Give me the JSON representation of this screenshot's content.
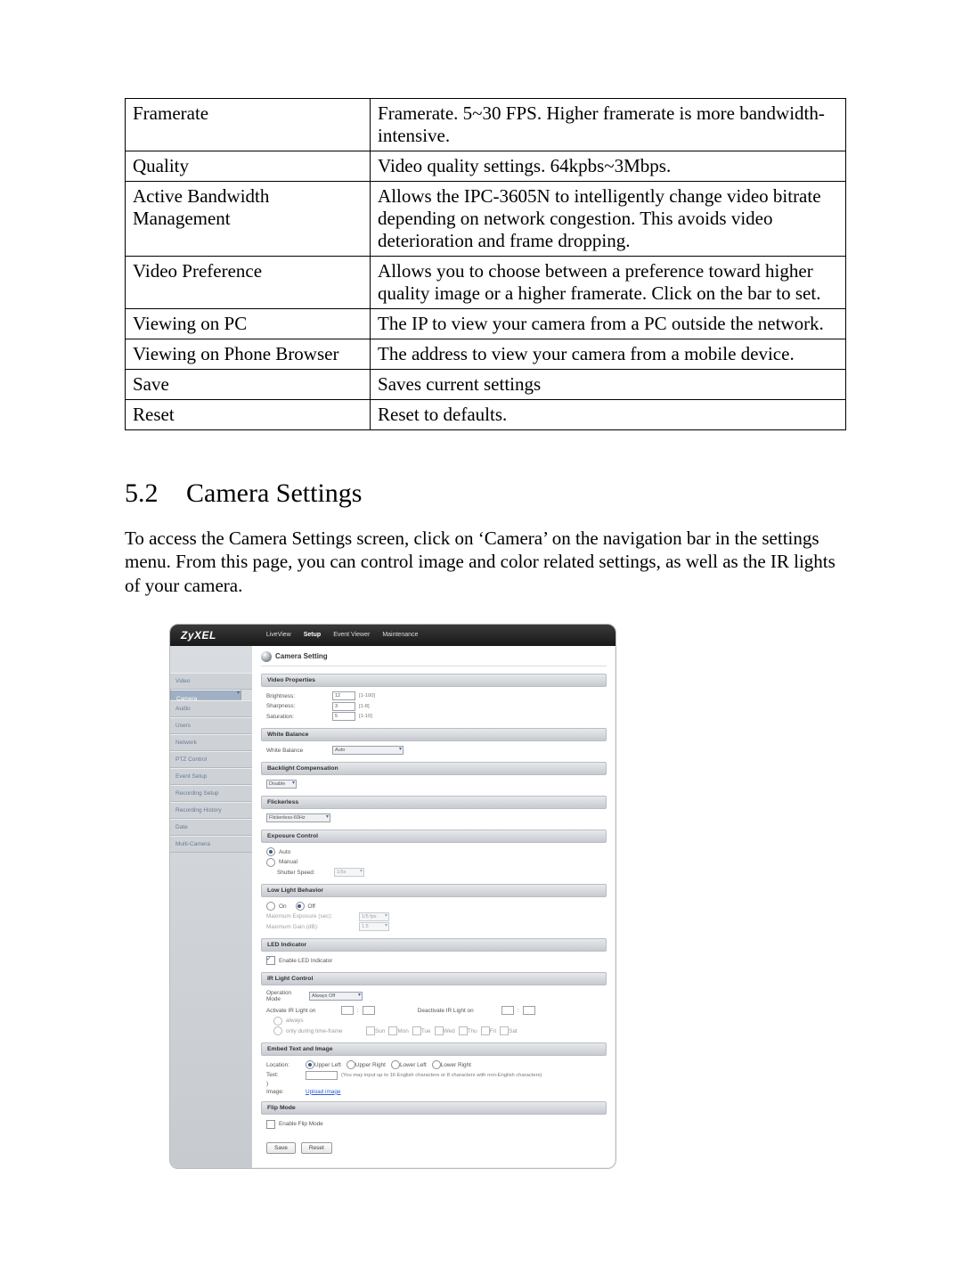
{
  "table": [
    {
      "term": "Framerate",
      "desc": "Framerate. 5~30 FPS. Higher framerate is more bandwidth-intensive."
    },
    {
      "term": "Quality",
      "desc": "Video quality settings. 64kpbs~3Mbps."
    },
    {
      "term": "Active Bandwidth Management",
      "desc": "Allows the IPC-3605N to intelligently change video bitrate depending on network congestion. This avoids video deterioration and frame dropping."
    },
    {
      "term": "Video Preference",
      "desc": "Allows you to choose between a preference toward higher quality image or a higher framerate. Click on the bar to set."
    },
    {
      "term": "Viewing on PC",
      "desc": "The IP to view your camera from a PC outside the network."
    },
    {
      "term": "Viewing on Phone Browser",
      "desc": "The address to view your camera from a mobile device."
    },
    {
      "term": "Save",
      "desc": "Saves current settings"
    },
    {
      "term": "Reset",
      "desc": "Reset to defaults."
    }
  ],
  "heading": {
    "num": "5.2",
    "text": "Camera Settings"
  },
  "intro": "To access the Camera Settings screen, click on ‘Camera’ on the navigation bar in the settings menu. From this page, you can control image and color related settings, as well as the IR lights of your camera.",
  "fig": {
    "brand": "ZyXEL",
    "tabs": [
      "LiveView",
      "Setup",
      "Event Viewer",
      "Maintenance"
    ],
    "activeTab": 1,
    "nav": [
      "Video",
      "Camera",
      "Audio",
      "Users",
      "Network",
      "PTZ Control",
      "Event Setup",
      "Recording Setup",
      "Recording History",
      "Date",
      "Multi-Camera"
    ],
    "navActive": 1,
    "title": "Camera Setting",
    "vp": {
      "name": "Video Properties",
      "brightness": {
        "label": "Brightness:",
        "val": "12",
        "hint": "[1-100]"
      },
      "sharpness": {
        "label": "Sharpness:",
        "val": "3",
        "hint": "[1-8]"
      },
      "saturation": {
        "label": "Saturation:",
        "val": "5",
        "hint": "[1-10]"
      }
    },
    "wb": {
      "name": "White Balance",
      "label": "White Balance",
      "val": "Auto"
    },
    "blc": {
      "name": "Backlight Compensation",
      "val": "Disable"
    },
    "fl": {
      "name": "Flickerless",
      "val": "Flickerless-60Hz"
    },
    "exp": {
      "name": "Exposure Control",
      "auto": "Auto",
      "manual": "Manual",
      "shutterLabel": "Shutter Speed:",
      "shutterVal": "1/5s"
    },
    "ll": {
      "name": "Low Light Behavior",
      "on": "On",
      "off": "Off",
      "maxExpLabel": "Maximum Exposure (sec):",
      "maxExpVal": "1/5 fps",
      "maxGainLabel": "Maximum Gain (dB):",
      "maxGainVal": "1.5"
    },
    "led": {
      "name": "LED Indicator",
      "ck": "Enable LED Indicator"
    },
    "ir": {
      "name": "IR Light Control",
      "opLabel": "Operation\nMode",
      "opVal": "Always Off",
      "actLabel": "Activate IR Light on",
      "deactLabel": "Deactivate IR Light on",
      "m1": "always",
      "m2": "only during time-frame",
      "days": [
        "Sun",
        "Mon",
        "Tue",
        "Wed",
        "Thu",
        "Fri",
        "Sat"
      ]
    },
    "embed": {
      "name": "Embed Text and Image",
      "locLabel": "Location:",
      "loc": [
        "Upper Left",
        "Upper Right",
        "Lower Left",
        "Lower Right"
      ],
      "textLabel": "Text:",
      "textHint": "(You may input up to 16 English characters or 8 characters with non-English characters)",
      "textVal": ")",
      "imgLabel": "Image:",
      "imgLink": "Upload image"
    },
    "flip": {
      "name": "Flip Mode",
      "ck": "Enable Flip Mode"
    },
    "save": "Save",
    "reset": "Reset"
  }
}
